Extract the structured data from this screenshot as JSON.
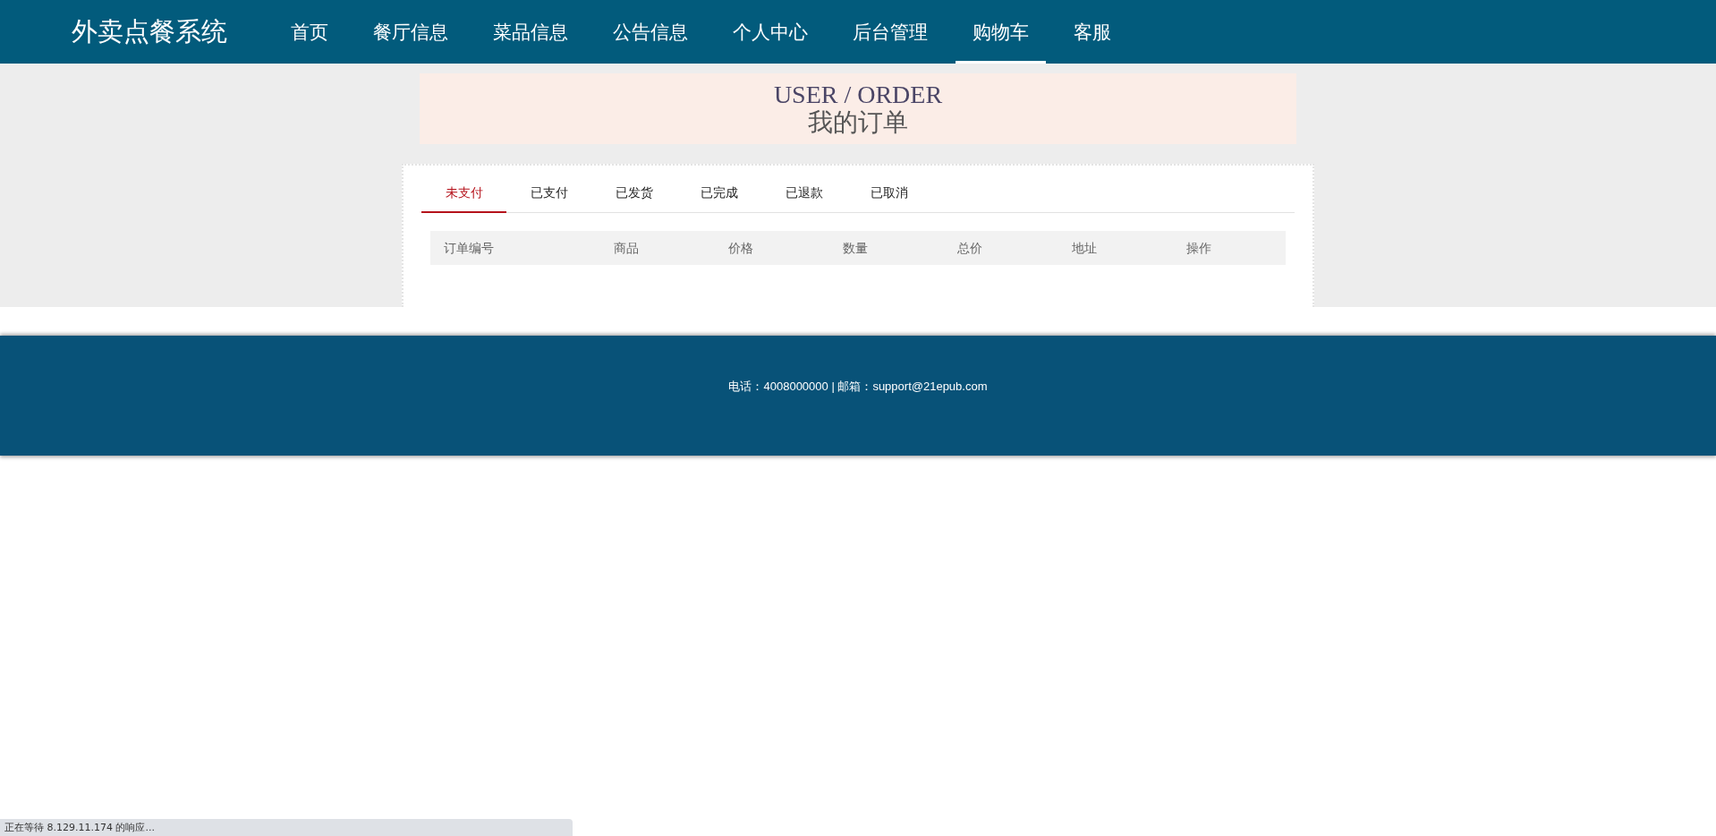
{
  "header": {
    "brand": "外卖点餐系统",
    "nav": [
      {
        "label": "首页",
        "selected": false
      },
      {
        "label": "餐厅信息",
        "selected": false
      },
      {
        "label": "菜品信息",
        "selected": false
      },
      {
        "label": "公告信息",
        "selected": false
      },
      {
        "label": "个人中心",
        "selected": false
      },
      {
        "label": "后台管理",
        "selected": false
      },
      {
        "label": "购物车",
        "selected": true
      },
      {
        "label": "客服",
        "selected": false
      }
    ]
  },
  "banner": {
    "title": "USER / ORDER",
    "subtitle": "我的订单"
  },
  "tabs": [
    {
      "label": "未支付",
      "selected": true
    },
    {
      "label": "已支付",
      "selected": false
    },
    {
      "label": "已发货",
      "selected": false
    },
    {
      "label": "已完成",
      "selected": false
    },
    {
      "label": "已退款",
      "selected": false
    },
    {
      "label": "已取消",
      "selected": false
    }
  ],
  "table": {
    "columns": [
      "订单编号",
      "商品",
      "价格",
      "数量",
      "总价",
      "地址",
      "操作"
    ]
  },
  "footer": {
    "text": "电话：4008000000 | 邮箱：support@21epub.com"
  },
  "status_bar": {
    "text": "正在等待 8.129.11.174 的响应..."
  }
}
